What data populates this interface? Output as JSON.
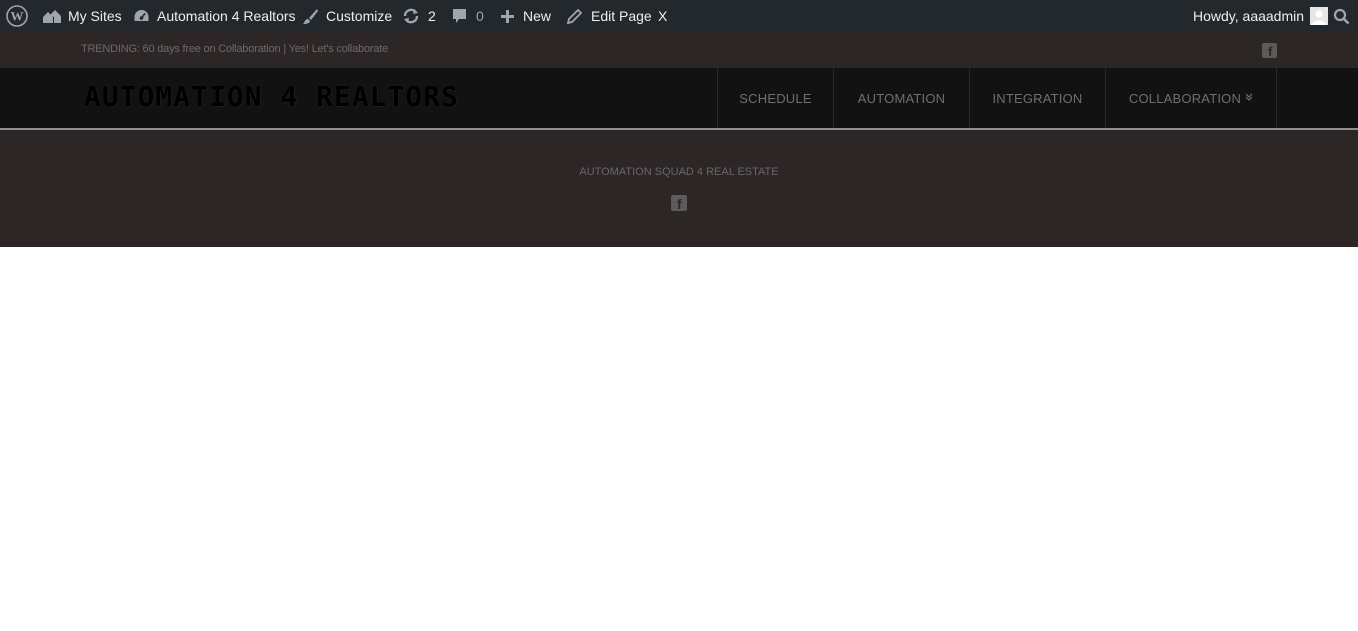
{
  "adminbar": {
    "wp_logo_icon": "wordpress-icon",
    "my_sites": "My Sites",
    "site_name": "Automation 4 Realtors",
    "customize": "Customize",
    "updates_count": "2",
    "comments_count": "0",
    "new_label": "New",
    "edit_page": "Edit Page",
    "close_x": "X",
    "howdy": "Howdy, aaaadmin"
  },
  "topbar": {
    "trending": "TRENDING: 60 days free on Collaboration | Yes! Let's collaborate"
  },
  "header": {
    "logo": "AUTOMATION 4 REALTORS",
    "nav": [
      {
        "label": "SCHEDULE"
      },
      {
        "label": "AUTOMATION"
      },
      {
        "label": "INTEGRATION"
      },
      {
        "label": "COLLABORATION"
      }
    ]
  },
  "footer": {
    "tagline": "AUTOMATION SQUAD 4 REAL ESTATE"
  },
  "colors": {
    "adminbar_bg": "#23282d",
    "topbar_bg": "#2c2627",
    "header_bg": "#121212",
    "band_bg": "#2c2627"
  }
}
